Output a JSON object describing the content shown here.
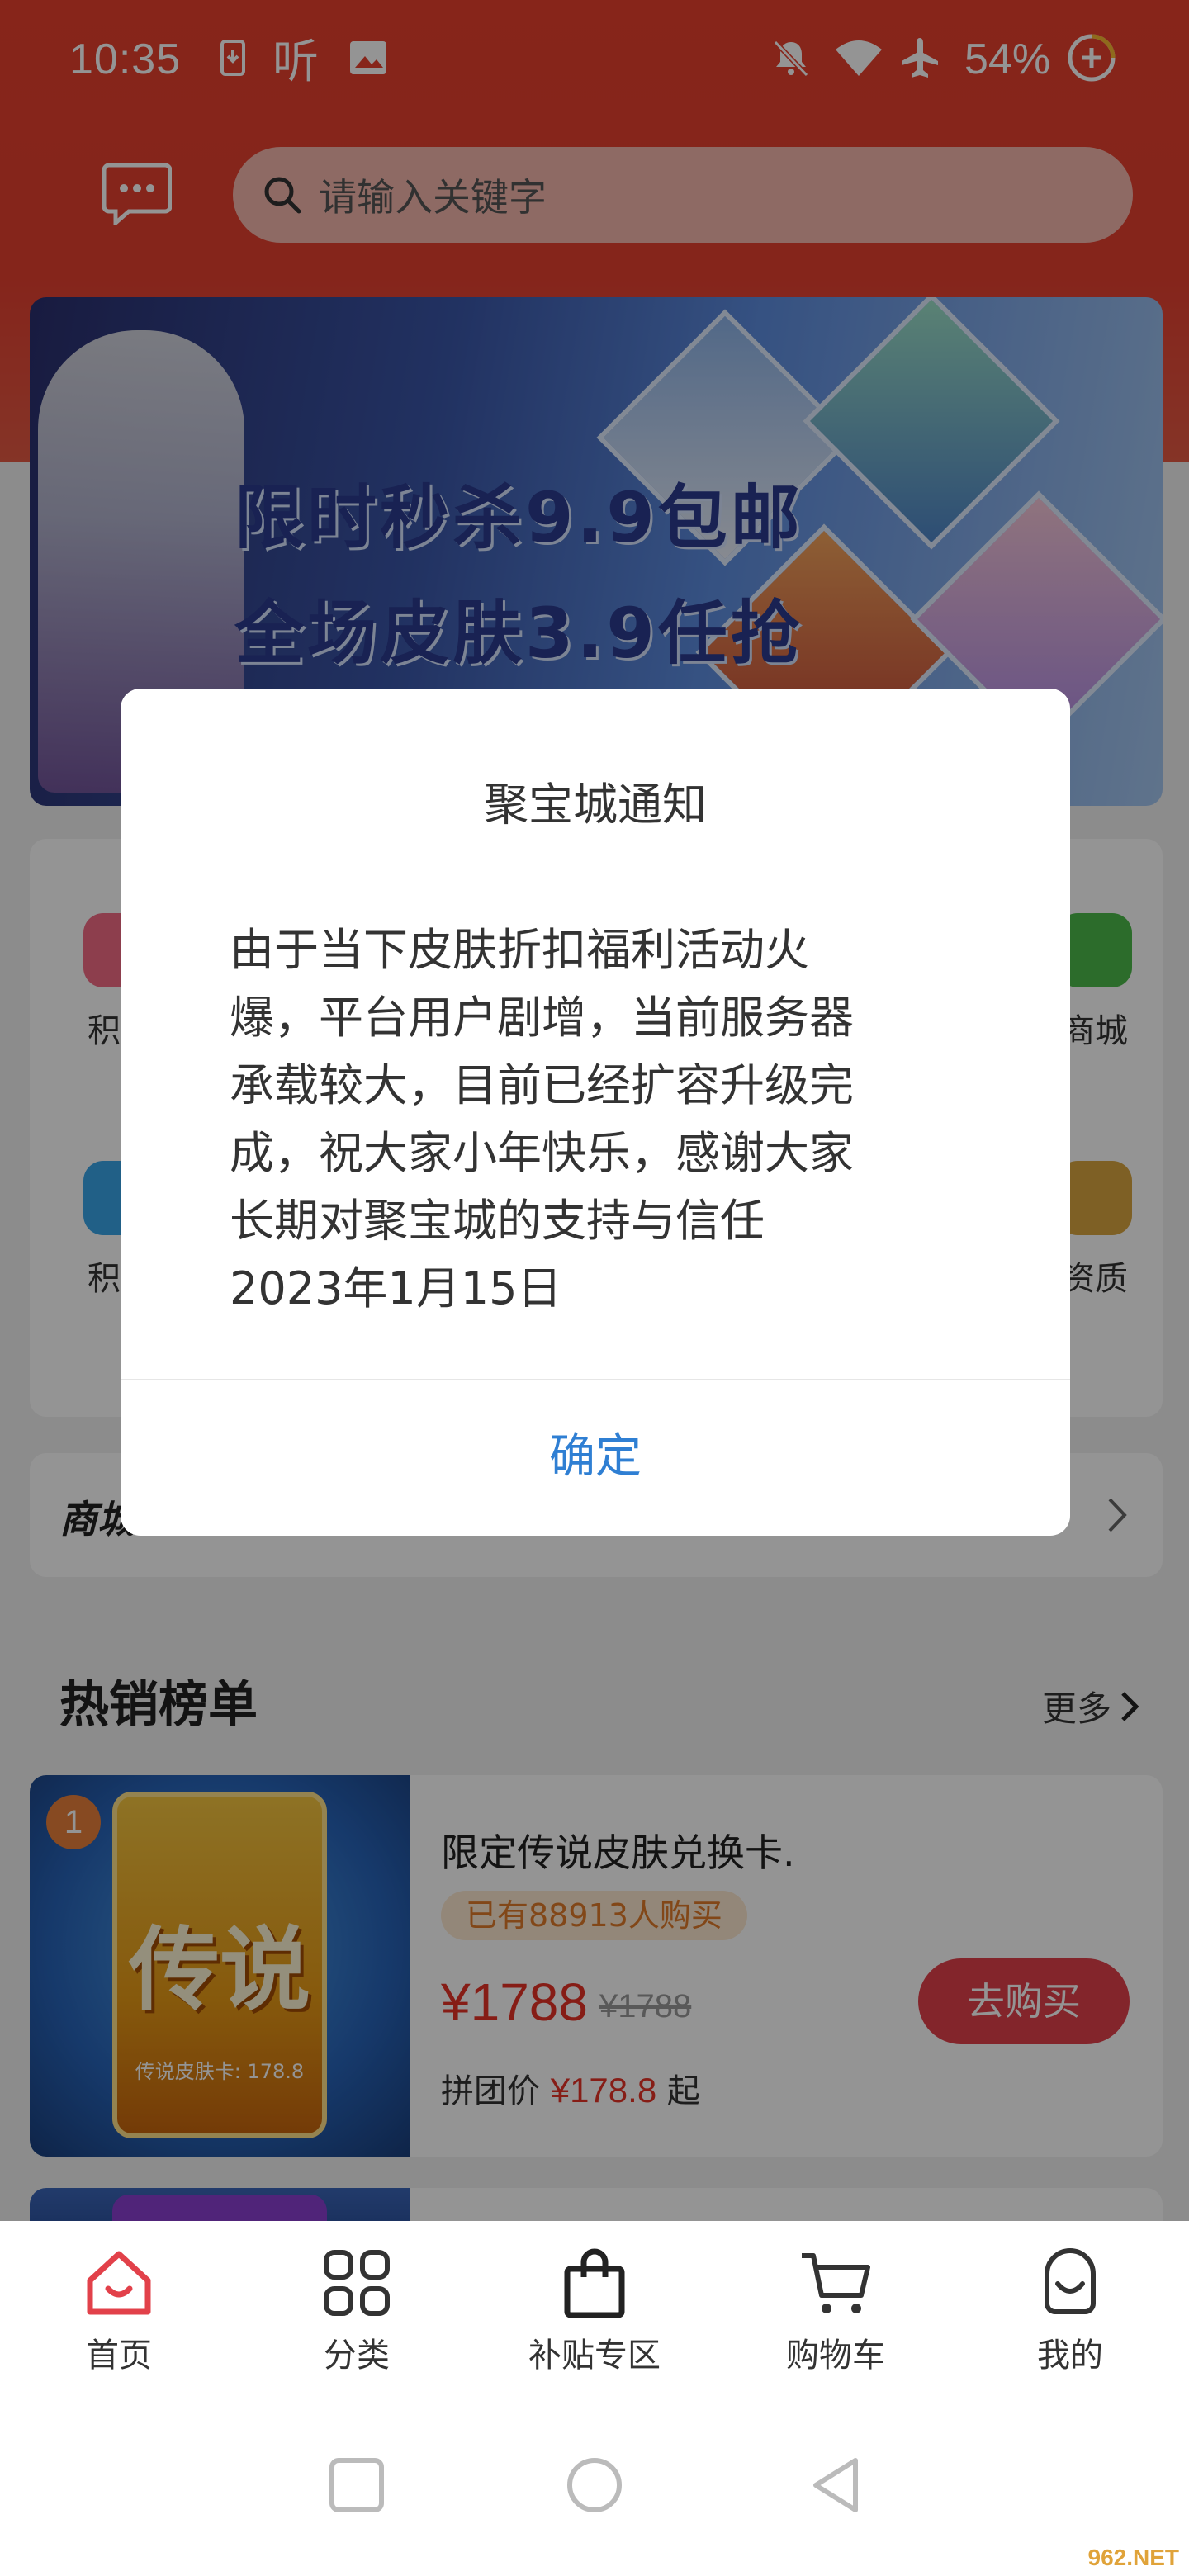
{
  "status_bar": {
    "time": "10:35",
    "ting_label": "听",
    "battery": "54%",
    "icons": [
      "download-icon",
      "image-icon",
      "mute-icon",
      "wifi-icon",
      "airplane-icon",
      "battery-saver-icon"
    ]
  },
  "search": {
    "placeholder": "请输入关键字"
  },
  "banner": {
    "line1": "限时秒杀9.9包邮",
    "line2": "全场皮肤3.9任抢"
  },
  "grid": {
    "items": [
      {
        "label": "积分"
      },
      {
        "label": "商城"
      },
      {
        "label": "积分"
      },
      {
        "label": "资质"
      }
    ]
  },
  "notice_bar": {
    "title": "商城"
  },
  "hot": {
    "title": "热销榜单",
    "more": "更多"
  },
  "product": {
    "rank": "1",
    "card_big_text": "传说",
    "card_small_text": "传说皮肤卡: 178.8",
    "name": "限定传说皮肤兑换卡.",
    "sold": "已有88913人购买",
    "price": "¥1788",
    "old_price": "¥1788",
    "group_label": "拼团价",
    "group_price": "¥178.8",
    "group_suffix": "起",
    "buy_label": "去购买"
  },
  "dialog": {
    "title": "聚宝城通知",
    "body": "由于当下皮肤折扣福利活动火\n爆，平台用户剧增，当前服务器\n承载较大，目前已经扩容升级完\n成，祝大家小年快乐，感谢大家\n长期对聚宝城的支持与信任\n2023年1月15日",
    "ok_label": "确定"
  },
  "tab_bar": {
    "tabs": [
      {
        "label": "首页"
      },
      {
        "label": "分类"
      },
      {
        "label": "补贴专区"
      },
      {
        "label": "购物车"
      },
      {
        "label": "我的"
      }
    ]
  },
  "watermark": "962.NET",
  "colors": {
    "brand_red": "#e8402e",
    "price_red": "#e73326",
    "dialog_button_blue": "#2f7fd3"
  }
}
